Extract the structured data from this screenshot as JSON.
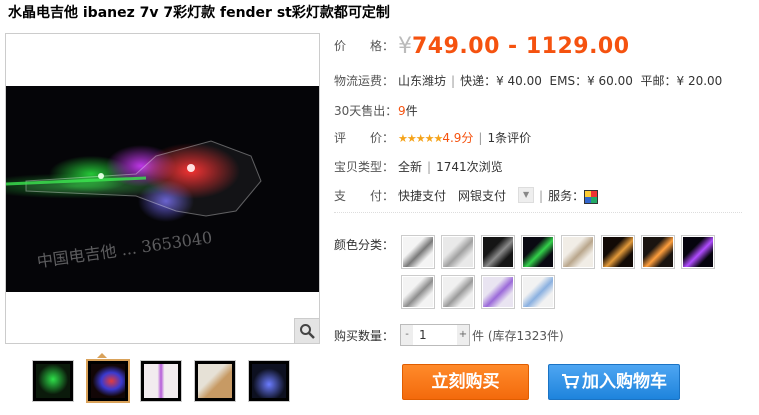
{
  "title": "水晶电吉他 ibanez 7v 7彩灯款 fender st彩灯款都可定制",
  "gallery": {
    "watermark": "中国电吉他 ... 3653040",
    "zoom_icon": "magnifier-icon",
    "thumbs": [
      {
        "colors": [
          "#0b1a0b",
          "#2ee04a"
        ]
      },
      {
        "colors": [
          "#120606",
          "#e33b3b"
        ]
      },
      {
        "colors": [
          "#f2ecef",
          "#b45ad8"
        ]
      },
      {
        "colors": [
          "#e6e1d6",
          "#c79a64"
        ]
      },
      {
        "colors": [
          "#0d1020",
          "#6b7cff"
        ]
      }
    ],
    "active_index": 1
  },
  "price": {
    "label": "价　　格：",
    "currency": "¥",
    "range": "749.00 - 1129.00",
    "color": "#f5520f"
  },
  "shipping": {
    "label": "物流运费：",
    "location": "山东潍坊",
    "express": "快递：¥ 40.00",
    "ems": "EMS：¥ 60.00",
    "mail": "平邮：¥ 20.00"
  },
  "sales": {
    "label": "30天售出：",
    "count": "9",
    "unit": "件"
  },
  "rating": {
    "label": "评　　价：",
    "stars": "★★★★★",
    "score": "4.9分",
    "reviews": "1条评价"
  },
  "type": {
    "label": "宝贝类型：",
    "condition": "全新",
    "views": "1741次浏览"
  },
  "payment": {
    "label": "支　　付：",
    "value": "快捷支付　网银支付",
    "service_label": "服务："
  },
  "colors": {
    "label": "颜色分类：",
    "swatches": [
      {
        "c": [
          "#f4f4f4",
          "#7a7a7a"
        ]
      },
      {
        "c": [
          "#e9e9e9",
          "#a0a0a0"
        ]
      },
      {
        "c": [
          "#151515",
          "#8a8a8a"
        ]
      },
      {
        "c": [
          "#0a0a12",
          "#33d14a"
        ]
      },
      {
        "c": [
          "#f1ede6",
          "#b9a68c"
        ]
      },
      {
        "c": [
          "#120a06",
          "#e39a3a"
        ]
      },
      {
        "c": [
          "#1a1410",
          "#ff9f3d"
        ]
      },
      {
        "c": [
          "#06040e",
          "#b04cff"
        ]
      },
      {
        "c": [
          "#f3f3f3",
          "#8d8d8d"
        ]
      },
      {
        "c": [
          "#f0f0f0",
          "#9a9a9a"
        ]
      },
      {
        "c": [
          "#e9e4f1",
          "#9b6ad9"
        ]
      },
      {
        "c": [
          "#f2f2f2",
          "#8ab0e0"
        ]
      }
    ]
  },
  "quantity": {
    "label": "购买数量：",
    "value": "1",
    "stock": "件 (库存1323件)",
    "minus": "-",
    "plus": "+"
  },
  "buttons": {
    "buy": "立刻购买",
    "cart": "加入购物车"
  }
}
